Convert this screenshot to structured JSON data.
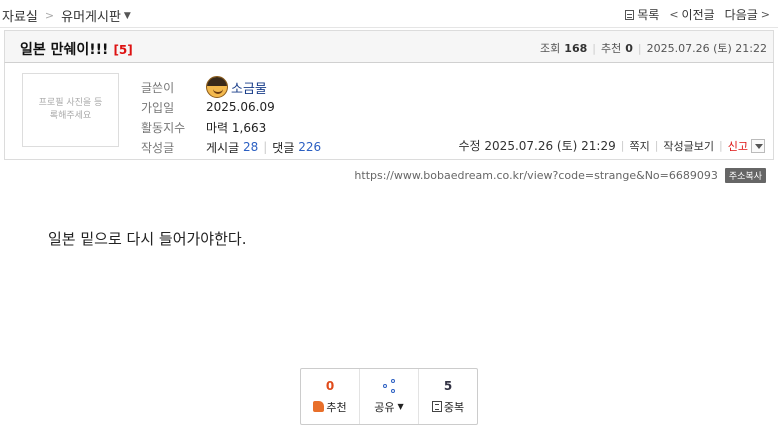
{
  "breadcrumb": {
    "root": "자료실",
    "sep": ">",
    "board": "유머게시판",
    "caret": "▼"
  },
  "topnav": {
    "list": "목록",
    "prev": "이전글",
    "prev_arrow": "<",
    "next": "다음글",
    "next_arrow": ">"
  },
  "post": {
    "title": "일본 만쉐이!!!",
    "comment_count": "[5]",
    "views_label": "조회",
    "views": "168",
    "recommend_label": "추천",
    "recommend": "0",
    "datetime": "2025.07.26 (토) 21:22"
  },
  "author": {
    "photo_placeholder": "프로필 사진을 등록해주세요",
    "writer_label": "글쓴이",
    "nickname": "소금물",
    "joined_label": "가입일",
    "joined": "2025.06.09",
    "activity_label": "활동지수",
    "activity": "마력 1,663",
    "posts_label": "작성글",
    "posts_text": "게시글",
    "posts_count": "28",
    "comments_text": "댓글",
    "comments_count": "226"
  },
  "actions": {
    "modified": "수정 2025.07.26 (토) 21:29",
    "message": "쪽지",
    "view_posts": "작성글보기",
    "report": "신고"
  },
  "url": {
    "text": "https://www.bobaedream.co.kr/view?code=strange&No=6689093",
    "copy_label": "주소복사"
  },
  "body": {
    "text": "일본 밑으로 다시 들어가야한다."
  },
  "reactions": {
    "recommend_count": "0",
    "recommend_label": "추천",
    "share_label": "공유",
    "duplicate_count": "5",
    "duplicate_label": "중복"
  },
  "colors": {
    "accent_red": "#d11111",
    "link_blue": "#2b5fc2",
    "recommend_orange": "#e04a1a"
  }
}
